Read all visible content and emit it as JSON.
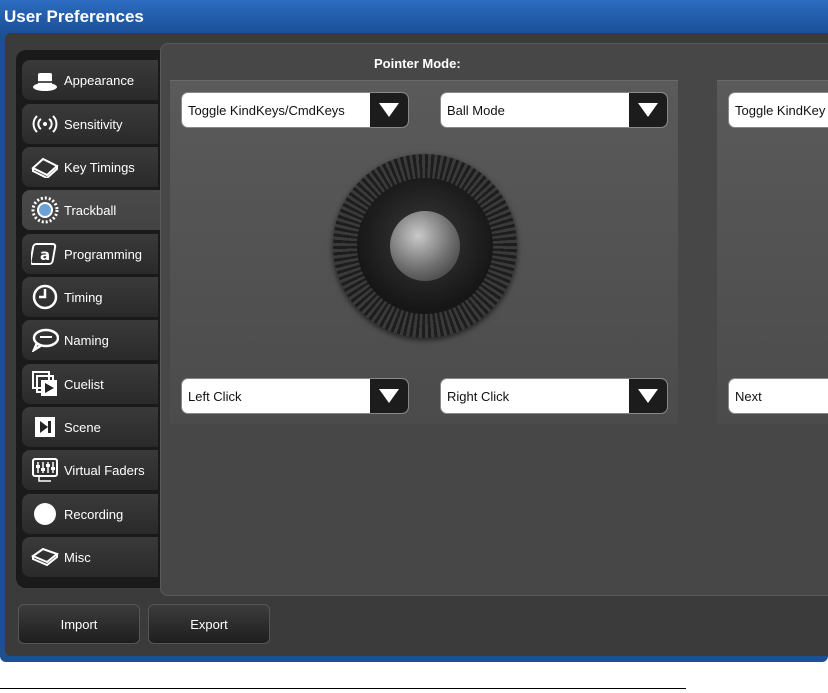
{
  "window": {
    "title": "User Preferences"
  },
  "sidebar": {
    "items": [
      {
        "label": "Appearance",
        "icon": "hat-icon",
        "active": false
      },
      {
        "label": "Sensitivity",
        "icon": "signal-icon",
        "active": false
      },
      {
        "label": "Key Timings",
        "icon": "key-icon",
        "active": false
      },
      {
        "label": "Trackball",
        "icon": "trackball-icon",
        "active": true
      },
      {
        "label": "Programming",
        "icon": "at-icon",
        "active": false
      },
      {
        "label": "Timing",
        "icon": "clock-icon",
        "active": false
      },
      {
        "label": "Naming",
        "icon": "speech-bubble-icon",
        "active": false
      },
      {
        "label": "Cuelist",
        "icon": "cuelist-icon",
        "active": false
      },
      {
        "label": "Scene",
        "icon": "scene-icon",
        "active": false
      },
      {
        "label": "Virtual Faders",
        "icon": "faders-icon",
        "active": false
      },
      {
        "label": "Recording",
        "icon": "record-icon",
        "active": false
      },
      {
        "label": "Misc",
        "icon": "key-icon",
        "active": false
      }
    ]
  },
  "main": {
    "pointer_mode_label": "Pointer Mode:",
    "left_panel": {
      "top_left": "Toggle KindKeys/CmdKeys",
      "top_right": "Ball Mode",
      "bottom_left": "Left Click",
      "bottom_right": "Right Click"
    },
    "right_panel": {
      "top_left": "Toggle KindKey",
      "bottom_left": "Next"
    }
  },
  "footer": {
    "import_label": "Import",
    "export_label": "Export"
  },
  "colors": {
    "title_bar": "#1e4f8f",
    "background": "#3b3b3b",
    "panel": "#555555"
  }
}
